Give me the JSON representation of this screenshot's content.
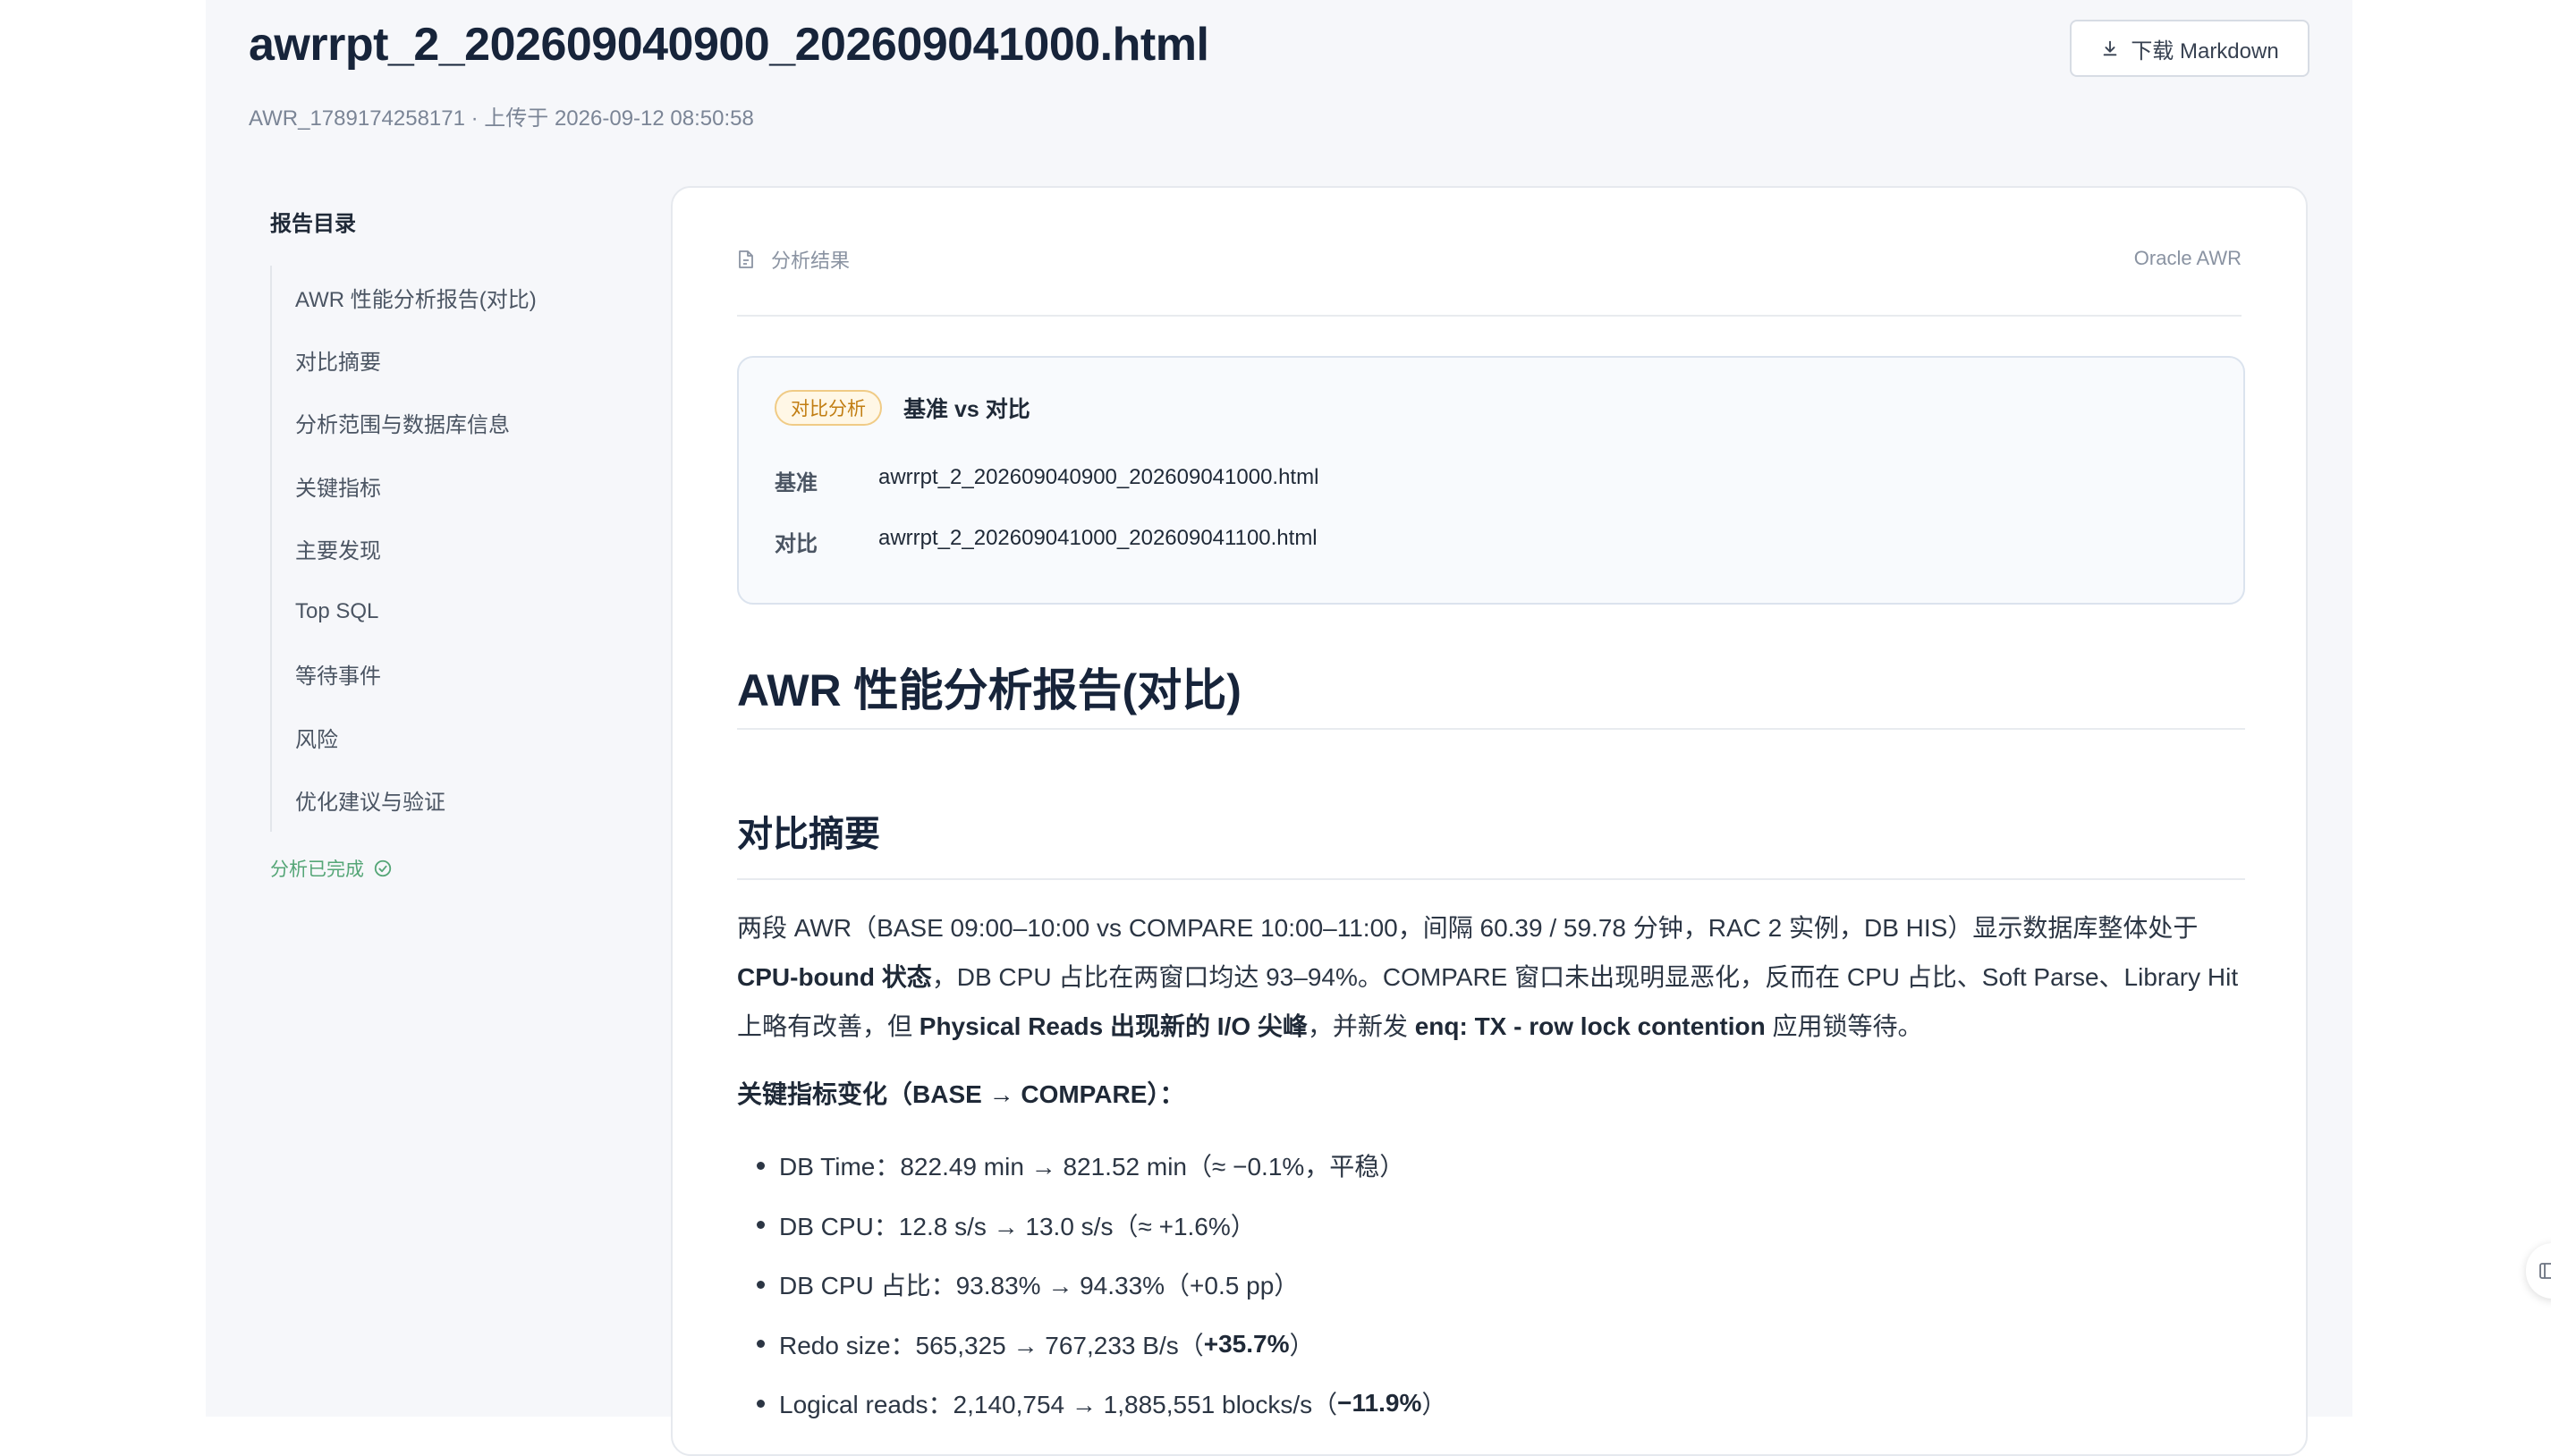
{
  "header": {
    "title": "awrrpt_2_202609040900_202609041000.html",
    "meta": "AWR_1789174258171 · 上传于 2026-09-12 08:50:58",
    "download_label": "下载 Markdown"
  },
  "toc": {
    "title": "报告目录",
    "items": [
      {
        "label": "AWR 性能分析报告(对比)"
      },
      {
        "label": "对比摘要"
      },
      {
        "label": "分析范围与数据库信息"
      },
      {
        "label": "关键指标"
      },
      {
        "label": "主要发现"
      },
      {
        "label": "Top SQL"
      },
      {
        "label": "等待事件"
      },
      {
        "label": "风险"
      },
      {
        "label": "优化建议与验证"
      }
    ],
    "status": "分析已完成"
  },
  "card": {
    "crumb": "分析结果",
    "engine": "Oracle AWR"
  },
  "compare": {
    "badge": "对比分析",
    "title": "基准 vs 对比",
    "base_label": "基准",
    "base_value": "awrrpt_2_202609040900_202609041000.html",
    "target_label": "对比",
    "target_value": "awrrpt_2_202609041000_202609041100.html"
  },
  "report": {
    "h1": "AWR 性能分析报告(对比)",
    "h2": "对比摘要",
    "para": {
      "t1": "两段 AWR（BASE 09:00–10:00 vs COMPARE 10:00–11:00，间隔 60.39 / 59.78 分钟，RAC 2 实例，DB HIS）显示数据库整体处于 ",
      "b1": "CPU-bound 状态",
      "t2": "，DB CPU 占比在两窗口均达 93–94%。COMPARE 窗口未出现明显恶化，反而在 CPU 占比、Soft Parse、Library Hit 上略有改善，但 ",
      "b2": "Physical Reads 出现新的 I/O 尖峰",
      "t3": "，并新发 ",
      "b3": "enq: TX - row lock contention",
      "t4": " 应用锁等待。"
    },
    "metrics_heading": "关键指标变化（BASE → COMPARE）：",
    "bullets": [
      {
        "text": "DB Time：822.49 min → 821.52 min（≈ −0.1%，平稳）",
        "bold": "",
        "tail": ""
      },
      {
        "text": "DB CPU：12.8 s/s → 13.0 s/s（≈ +1.6%）",
        "bold": "",
        "tail": ""
      },
      {
        "text": "DB CPU 占比：93.83% → 94.33%（+0.5 pp）",
        "bold": "",
        "tail": ""
      },
      {
        "text": "Redo size：565,325 → 767,233 B/s（",
        "bold": "+35.7%",
        "tail": "）"
      },
      {
        "text": "Logical reads：2,140,754 → 1,885,551 blocks/s（",
        "bold": "−11.9%",
        "tail": "）"
      }
    ]
  },
  "colors": {
    "accent_badge": "#c17d12",
    "status_green": "#55a677",
    "title": "#17243a"
  }
}
